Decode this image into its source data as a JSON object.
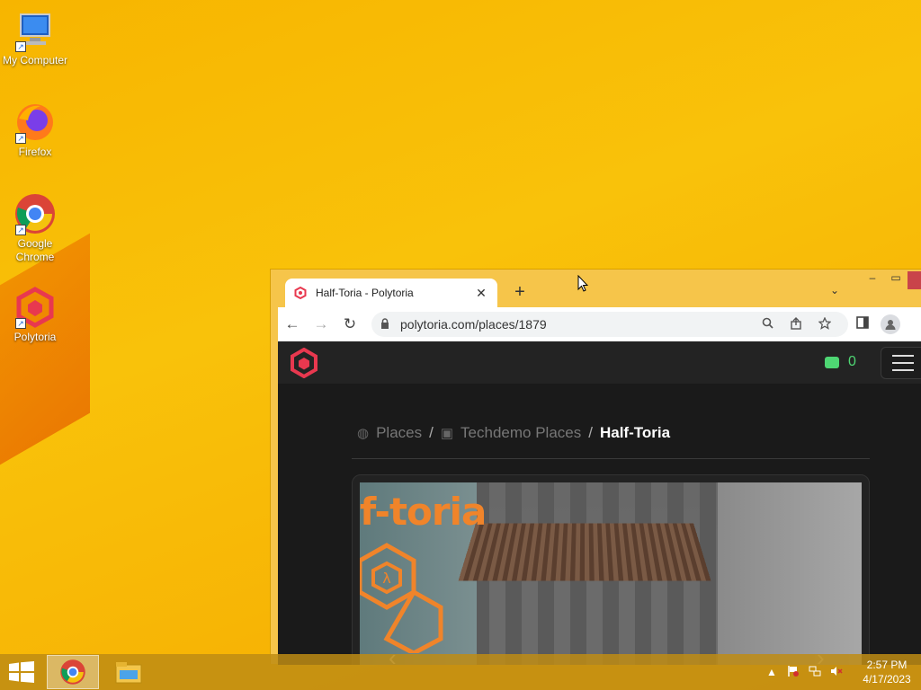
{
  "desktop": {
    "icons": [
      {
        "label": "My Computer"
      },
      {
        "label": "Firefox"
      },
      {
        "label": "Google Chrome"
      },
      {
        "label": "Polytoria"
      }
    ]
  },
  "browser": {
    "tab": {
      "title": "Half-Toria - Polytoria",
      "close": "✕"
    },
    "new_tab": "+",
    "tab_menu": "⌄",
    "window": {
      "minimize": "–",
      "maximize": "▭",
      "close": "✕"
    },
    "toolbar": {
      "back": "←",
      "forward": "→",
      "reload": "↻",
      "lock": "🔒",
      "url": "polytoria.com/places/1879"
    }
  },
  "site": {
    "bricks_count": "0",
    "breadcrumb": {
      "places": "Places",
      "category": "Techdemo Places",
      "current": "Half-Toria",
      "sep": "/"
    },
    "gallery": {
      "title_text": "f-toria",
      "prev": "‹",
      "next": "›"
    }
  },
  "taskbar": {
    "time": "2:57 PM",
    "date": "4/17/2023",
    "tray_up": "▲"
  },
  "colors": {
    "accent_red": "#e8384f",
    "bricks_green": "#4ed673",
    "desktop_yellow": "#f9c20a"
  }
}
